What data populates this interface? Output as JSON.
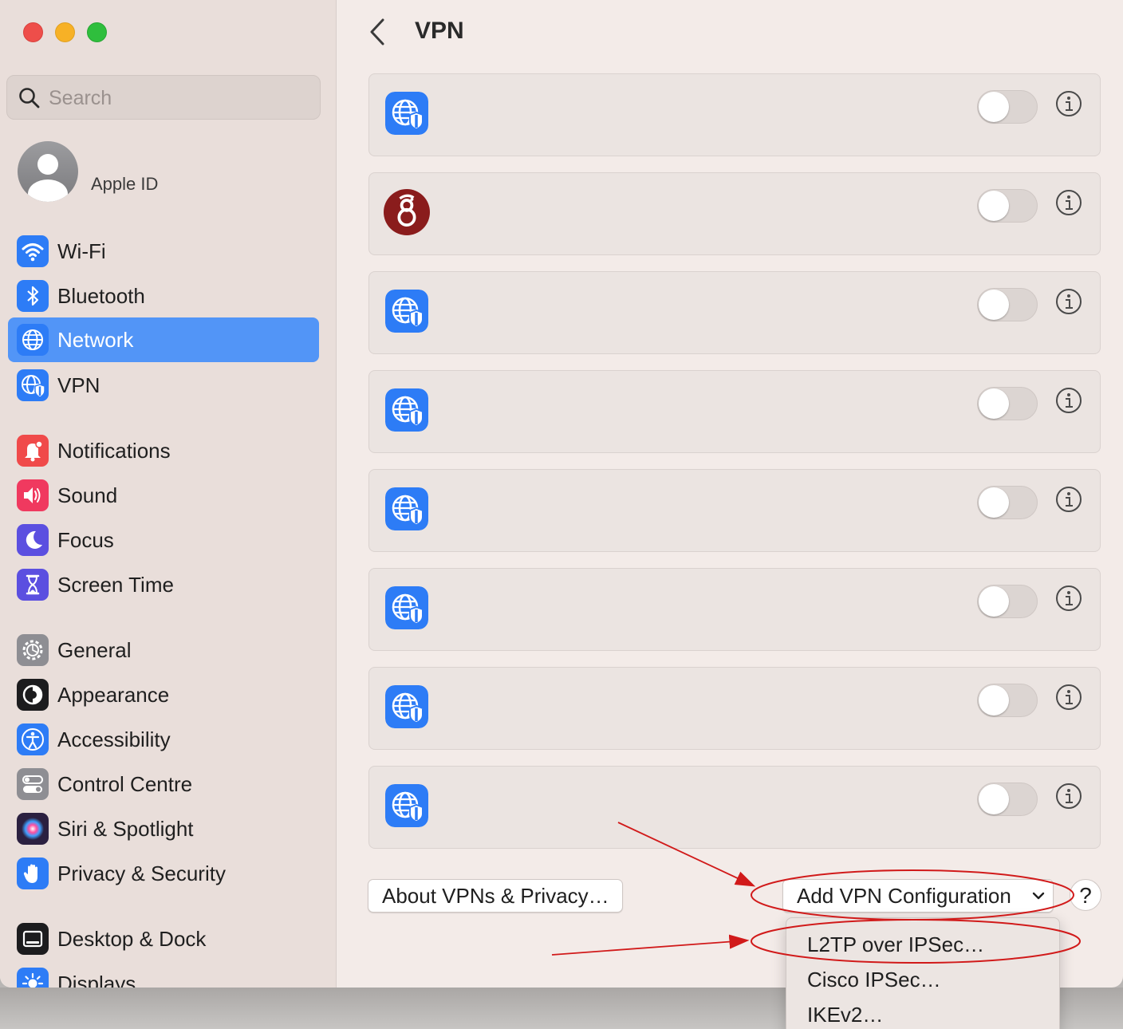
{
  "window": {
    "title": "VPN"
  },
  "search": {
    "placeholder": "Search"
  },
  "account": {
    "label": "Apple ID"
  },
  "sidebar": {
    "items": [
      {
        "label": "Wi-Fi",
        "icon": "wifi-icon",
        "color": "#2d7cf6"
      },
      {
        "label": "Bluetooth",
        "icon": "bluetooth-icon",
        "color": "#2d7cf6"
      },
      {
        "label": "Network",
        "icon": "network-globe-icon",
        "color": "#2d7cf6",
        "selected": true
      },
      {
        "label": "VPN",
        "icon": "vpn-globe-icon",
        "color": "#2d7cf6"
      },
      {
        "label": "Notifications",
        "icon": "bell-icon",
        "color": "#f04a4a"
      },
      {
        "label": "Sound",
        "icon": "speaker-icon",
        "color": "#f0395f"
      },
      {
        "label": "Focus",
        "icon": "moon-icon",
        "color": "#5b4fe0"
      },
      {
        "label": "Screen Time",
        "icon": "hourglass-icon",
        "color": "#5b4fe0"
      },
      {
        "label": "General",
        "icon": "gear-icon",
        "color": "#8e8e93"
      },
      {
        "label": "Appearance",
        "icon": "appearance-icon",
        "color": "#1c1c1e"
      },
      {
        "label": "Accessibility",
        "icon": "accessibility-icon",
        "color": "#2d7cf6"
      },
      {
        "label": "Control Centre",
        "icon": "control-centre-icon",
        "color": "#8e8e93"
      },
      {
        "label": "Siri & Spotlight",
        "icon": "siri-icon",
        "color": "#2b2040"
      },
      {
        "label": "Privacy & Security",
        "icon": "hand-icon",
        "color": "#2d7cf6"
      },
      {
        "label": "Desktop & Dock",
        "icon": "dock-icon",
        "color": "#1c1c1e"
      },
      {
        "label": "Displays",
        "icon": "sun-icon",
        "color": "#2d7cf6"
      }
    ]
  },
  "vpn_list": [
    {
      "icon": "vpn-globe-shield-icon",
      "enabled": false
    },
    {
      "icon": "wireguard-icon",
      "enabled": false
    },
    {
      "icon": "vpn-globe-shield-icon",
      "enabled": false
    },
    {
      "icon": "vpn-globe-shield-icon",
      "enabled": false
    },
    {
      "icon": "vpn-globe-shield-icon",
      "enabled": false
    },
    {
      "icon": "vpn-globe-shield-icon",
      "enabled": false
    },
    {
      "icon": "vpn-globe-shield-icon",
      "enabled": false
    },
    {
      "icon": "vpn-globe-shield-icon",
      "enabled": false
    }
  ],
  "footer": {
    "about_label": "About VPNs & Privacy…",
    "add_label": "Add VPN Configuration",
    "help_label": "?"
  },
  "dropdown": {
    "options": [
      "L2TP over IPSec…",
      "Cisco IPSec…",
      "IKEv2…"
    ]
  },
  "colors": {
    "accent": "#5295f7",
    "annotation": "#d11a1a",
    "vpn_icon": "#2d7cf6",
    "wireguard": "#8a1c1c"
  }
}
